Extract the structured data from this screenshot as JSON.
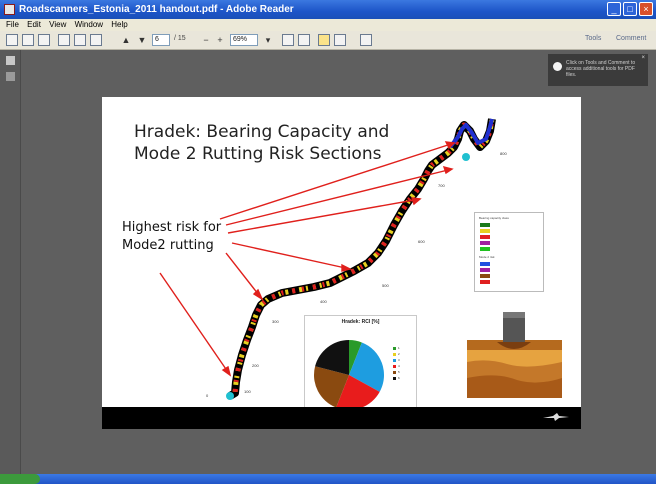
{
  "window": {
    "title": "Roadscanners_Estonia_2011 handout.pdf - Adobe Reader",
    "controls": {
      "minimize": "_",
      "maximize": "□",
      "close": "×"
    }
  },
  "menu": [
    "File",
    "Edit",
    "View",
    "Window",
    "Help"
  ],
  "toolbar": {
    "page_number": "6",
    "page_total": "/ 15",
    "zoom": "69%",
    "tools_label": "Tools",
    "comment_label": "Comment"
  },
  "tip": {
    "text": "Click on Tools and Comment to access additional tools for PDF files."
  },
  "slide": {
    "title_line1": "Hradek: Bearing Capacity and",
    "title_line2": "Mode 2 Rutting Risk Sections",
    "risk_line1": "Highest risk for",
    "risk_line2": "Mode2 rutting",
    "pie_title": "Hradek: RCI [%]",
    "pie_legend": [
      "1",
      "2",
      "3",
      "4",
      "5",
      "6"
    ],
    "legend1_title": "Bearing capacity class",
    "legend2_title": "Mode 2 risk",
    "km_labels": [
      "800",
      "700",
      "600",
      "500",
      "400",
      "300",
      "200",
      "100",
      "0"
    ]
  },
  "colors": {
    "titlebar": "#1d55c8",
    "viewer_bg": "#5f5f5f",
    "arrow": "#e0201c",
    "pie": [
      "#2a9a2a",
      "#1e9de0",
      "#e81c1c",
      "#8a4a10",
      "#111111"
    ]
  },
  "chart_data": {
    "type": "pie",
    "title": "Hradek: RCI [%]",
    "labels": [
      "Green",
      "Blue",
      "Red",
      "Brown",
      "Black"
    ],
    "values": [
      6,
      27,
      23,
      23,
      21
    ]
  }
}
